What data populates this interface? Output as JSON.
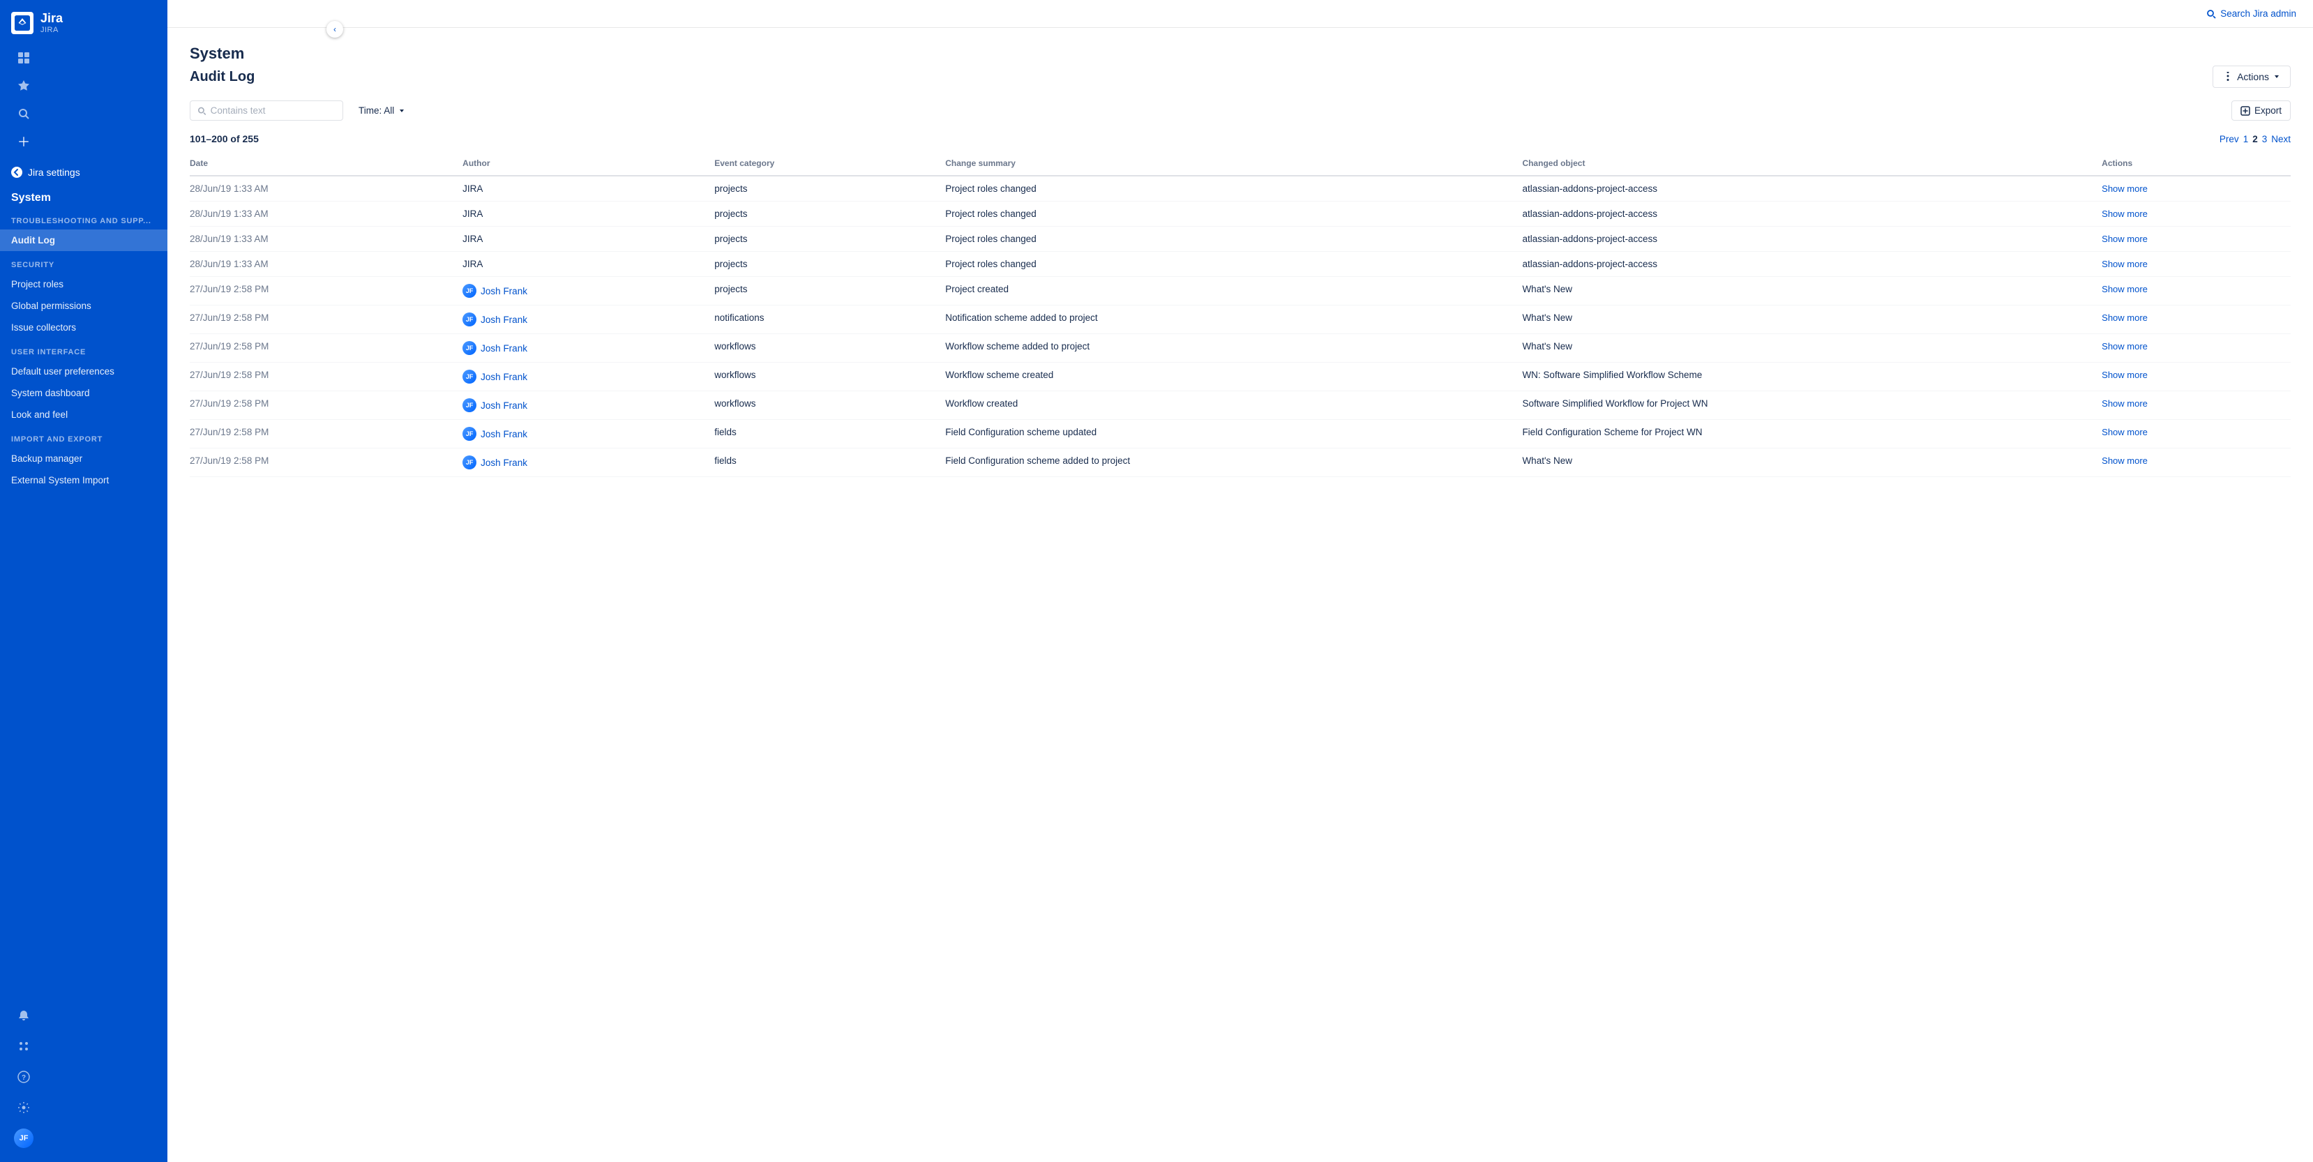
{
  "app": {
    "name": "Jira",
    "sub": "JIRA",
    "logo_initials": "J"
  },
  "sidebar": {
    "back_label": "Jira settings",
    "system_label": "System",
    "sections": [
      {
        "title": "TROUBLESHOOTING AND SUPP...",
        "items": [
          {
            "label": "Audit Log",
            "active": true
          }
        ]
      },
      {
        "title": "SECURITY",
        "items": [
          {
            "label": "Project roles",
            "active": false
          },
          {
            "label": "Global permissions",
            "active": false
          },
          {
            "label": "Issue collectors",
            "active": false
          }
        ]
      },
      {
        "title": "USER INTERFACE",
        "items": [
          {
            "label": "Default user preferences",
            "active": false
          },
          {
            "label": "System dashboard",
            "active": false
          },
          {
            "label": "Look and feel",
            "active": false
          }
        ]
      },
      {
        "title": "IMPORT AND EXPORT",
        "items": [
          {
            "label": "Backup manager",
            "active": false
          },
          {
            "label": "External System Import",
            "active": false
          }
        ]
      }
    ]
  },
  "topbar": {
    "search_label": "Search Jira admin"
  },
  "page": {
    "title": "System",
    "audit_log_title": "Audit Log",
    "actions_label": "Actions",
    "export_label": "Export",
    "search_placeholder": "Contains text",
    "time_filter": "Time: All",
    "results_text": "101–200 of 255",
    "pagination": {
      "prev": "Prev",
      "pages": [
        "1",
        "2",
        "3"
      ],
      "current": "2",
      "next": "Next"
    },
    "table_headers": [
      "Date",
      "Author",
      "Event category",
      "Change summary",
      "Changed object",
      "Actions"
    ],
    "rows": [
      {
        "date": "28/Jun/19 1:33 AM",
        "author": "JIRA",
        "author_is_link": false,
        "event_category": "projects",
        "change_summary": "Project roles changed",
        "changed_object": "atlassian-addons-project-access",
        "action": "Show more"
      },
      {
        "date": "28/Jun/19 1:33 AM",
        "author": "JIRA",
        "author_is_link": false,
        "event_category": "projects",
        "change_summary": "Project roles changed",
        "changed_object": "atlassian-addons-project-access",
        "action": "Show more"
      },
      {
        "date": "28/Jun/19 1:33 AM",
        "author": "JIRA",
        "author_is_link": false,
        "event_category": "projects",
        "change_summary": "Project roles changed",
        "changed_object": "atlassian-addons-project-access",
        "action": "Show more"
      },
      {
        "date": "28/Jun/19 1:33 AM",
        "author": "JIRA",
        "author_is_link": false,
        "event_category": "projects",
        "change_summary": "Project roles changed",
        "changed_object": "atlassian-addons-project-access",
        "action": "Show more"
      },
      {
        "date": "27/Jun/19 2:58 PM",
        "author": "Josh Frank",
        "author_is_link": true,
        "event_category": "projects",
        "change_summary": "Project created",
        "changed_object": "What's New",
        "action": "Show more"
      },
      {
        "date": "27/Jun/19 2:58 PM",
        "author": "Josh Frank",
        "author_is_link": true,
        "event_category": "notifications",
        "change_summary": "Notification scheme added to project",
        "changed_object": "What's New",
        "action": "Show more"
      },
      {
        "date": "27/Jun/19 2:58 PM",
        "author": "Josh Frank",
        "author_is_link": true,
        "event_category": "workflows",
        "change_summary": "Workflow scheme added to project",
        "changed_object": "What's New",
        "action": "Show more"
      },
      {
        "date": "27/Jun/19 2:58 PM",
        "author": "Josh Frank",
        "author_is_link": true,
        "event_category": "workflows",
        "change_summary": "Workflow scheme created",
        "changed_object": "WN: Software Simplified Workflow Scheme",
        "action": "Show more"
      },
      {
        "date": "27/Jun/19 2:58 PM",
        "author": "Josh Frank",
        "author_is_link": true,
        "event_category": "workflows",
        "change_summary": "Workflow created",
        "changed_object": "Software Simplified Workflow for Project WN",
        "action": "Show more"
      },
      {
        "date": "27/Jun/19 2:58 PM",
        "author": "Josh Frank",
        "author_is_link": true,
        "event_category": "fields",
        "change_summary": "Field Configuration scheme updated",
        "changed_object": "Field Configuration Scheme for Project WN",
        "action": "Show more"
      },
      {
        "date": "27/Jun/19 2:58 PM",
        "author": "Josh Frank",
        "author_is_link": true,
        "event_category": "fields",
        "change_summary": "Field Configuration scheme added to project",
        "changed_object": "What's New",
        "action": "Show more"
      }
    ]
  }
}
